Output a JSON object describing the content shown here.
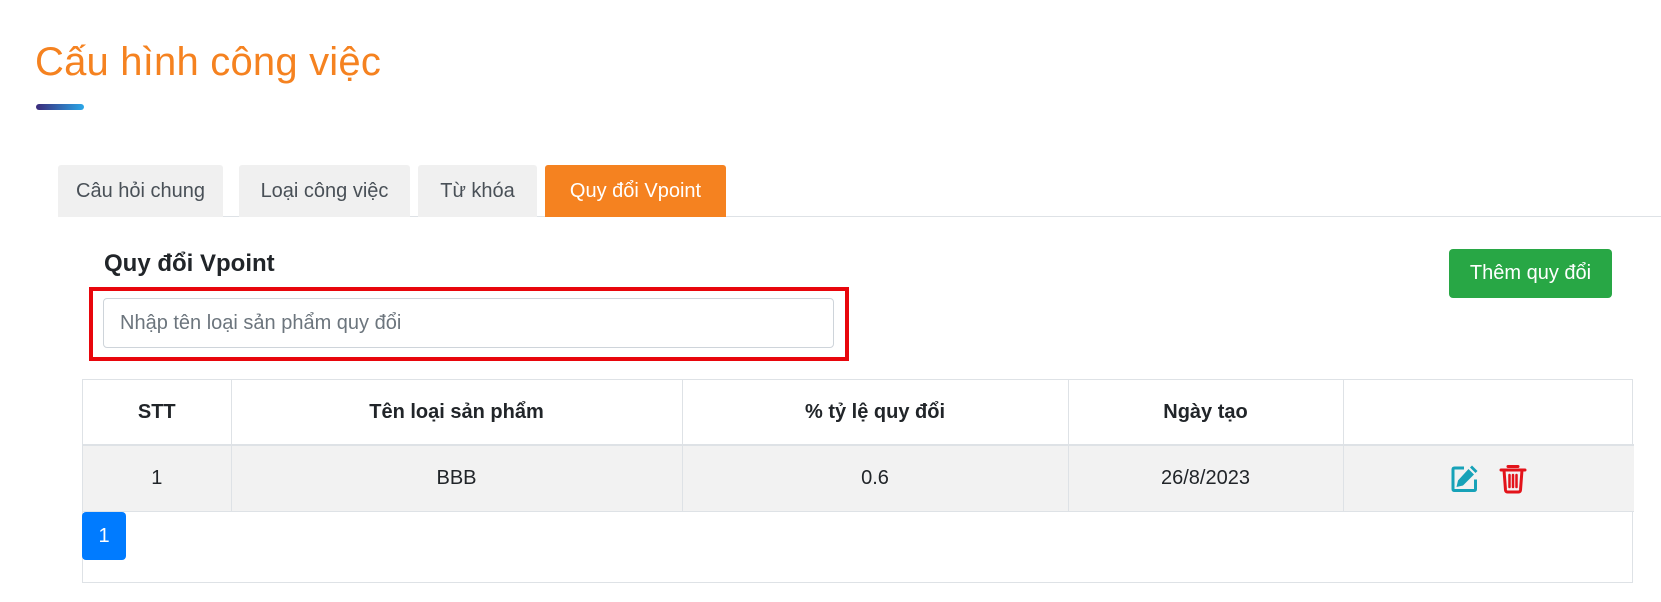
{
  "header": {
    "title": "Cấu hình công việc"
  },
  "tabs": [
    {
      "label": "Câu hỏi chung",
      "active": false
    },
    {
      "label": "Loại công việc",
      "active": false
    },
    {
      "label": "Từ khóa",
      "active": false
    },
    {
      "label": "Quy đổi Vpoint",
      "active": true
    }
  ],
  "section": {
    "title": "Quy đổi Vpoint",
    "add_button_label": "Thêm quy đổi"
  },
  "search": {
    "placeholder": "Nhập tên loại sản phẩm quy đổi",
    "value": ""
  },
  "table": {
    "columns": [
      "STT",
      "Tên loại sản phẩm",
      "% tỷ lệ quy đổi",
      "Ngày tạo",
      ""
    ],
    "rows": [
      {
        "stt": "1",
        "name": "BBB",
        "rate": "0.6",
        "created": "26/8/2023",
        "actions": [
          "edit-icon",
          "trash-icon"
        ]
      }
    ]
  },
  "pagination": {
    "current": "1"
  },
  "colors": {
    "title": "#f58220",
    "active_tab": "#f58220",
    "add_button": "#28a745",
    "edit_icon": "#17a2b8",
    "delete_icon": "#e3131a",
    "page_button": "#007bff",
    "highlight": "#e8060c"
  }
}
